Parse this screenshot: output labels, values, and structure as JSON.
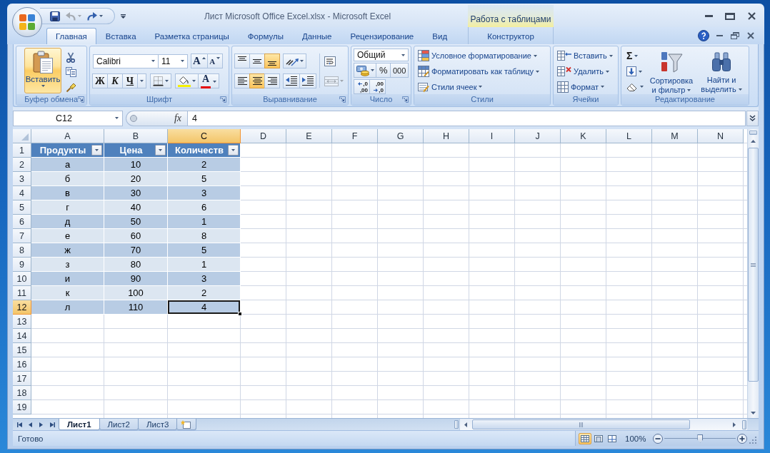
{
  "window": {
    "title": "Лист Microsoft Office Excel.xlsx - Microsoft Excel"
  },
  "quick_access": [
    {
      "kind": "save",
      "disabled": false,
      "dropdown": false
    },
    {
      "kind": "undo",
      "disabled": true,
      "dropdown": true
    },
    {
      "kind": "redo",
      "disabled": false,
      "dropdown": true
    }
  ],
  "tabs": [
    {
      "label": "Главная",
      "selected": true
    },
    {
      "label": "Вставка",
      "selected": false
    },
    {
      "label": "Разметка страницы",
      "selected": false
    },
    {
      "label": "Формулы",
      "selected": false
    },
    {
      "label": "Данные",
      "selected": false
    },
    {
      "label": "Рецензирование",
      "selected": false
    },
    {
      "label": "Вид",
      "selected": false
    }
  ],
  "context_tabs": {
    "title": "Работа с таблицами",
    "tabs": [
      {
        "label": "Конструктор",
        "selected": false
      }
    ]
  },
  "ribbon": {
    "clipboard": {
      "label": "Буфер обмена",
      "launcher": true,
      "paste": {
        "label": "Вставить",
        "highlighted": true
      },
      "tools": [
        {
          "kind": "cut"
        },
        {
          "kind": "copy"
        },
        {
          "kind": "format_painter"
        }
      ]
    },
    "font": {
      "label": "Шрифт",
      "launcher": true,
      "name": "Calibri",
      "size": "11",
      "size_buttons": [
        {
          "kind": "grow",
          "label": "A"
        },
        {
          "kind": "shrink",
          "label": "A"
        }
      ],
      "styles": [
        {
          "kind": "bold",
          "label": "Ж"
        },
        {
          "kind": "italic",
          "label": "К"
        },
        {
          "kind": "underline",
          "label": "Ч"
        }
      ],
      "font_color_label": "A"
    },
    "alignment": {
      "label": "Выравнивание",
      "launcher": true,
      "vertical": [
        {
          "kind": "top",
          "selected": false
        },
        {
          "kind": "middle",
          "selected": false
        },
        {
          "kind": "bottom",
          "selected": true
        }
      ],
      "horizontal": [
        {
          "kind": "left",
          "selected": false
        },
        {
          "kind": "center",
          "selected": true
        },
        {
          "kind": "right",
          "selected": false
        }
      ],
      "merge": {
        "disabled": true
      }
    },
    "number": {
      "label": "Число",
      "launcher": true,
      "format": "Общий",
      "percent": "%",
      "thousands": "000",
      "decimals": [
        {
          "kind": "increase",
          "lines": [
            ",0",
            ",00"
          ]
        },
        {
          "kind": "decrease",
          "lines": [
            ",00",
            ",0"
          ]
        }
      ]
    },
    "styles": {
      "label": "Стили",
      "items": [
        {
          "kind": "conditional",
          "label": "Условное форматирование"
        },
        {
          "kind": "table",
          "label": "Форматировать как таблицу"
        },
        {
          "kind": "cell_styles",
          "label": "Стили ячеек"
        }
      ]
    },
    "cells": {
      "label": "Ячейки",
      "items": [
        {
          "kind": "insert",
          "label": "Вставить"
        },
        {
          "kind": "delete",
          "label": "Удалить"
        },
        {
          "kind": "format",
          "label": "Формат"
        }
      ]
    },
    "editing": {
      "label": "Редактирование",
      "small": [
        {
          "kind": "sum",
          "label": "Σ"
        },
        {
          "kind": "fill"
        },
        {
          "kind": "clear"
        }
      ],
      "big": [
        {
          "kind": "sort",
          "label": "Сортировка и фильтр"
        },
        {
          "kind": "find",
          "label": "Найти и выделить"
        }
      ]
    }
  },
  "formula_bar": {
    "cell": "C12",
    "function_label": "fx",
    "value": "4"
  },
  "sheet": {
    "columns": [
      {
        "label": "A",
        "selected": false
      },
      {
        "label": "B",
        "selected": false
      },
      {
        "label": "C",
        "selected": true
      },
      {
        "label": "D",
        "selected": false
      },
      {
        "label": "E",
        "selected": false
      },
      {
        "label": "F",
        "selected": false
      },
      {
        "label": "G",
        "selected": false
      },
      {
        "label": "H",
        "selected": false
      },
      {
        "label": "I",
        "selected": false
      },
      {
        "label": "J",
        "selected": false
      },
      {
        "label": "K",
        "selected": false
      },
      {
        "label": "L",
        "selected": false
      },
      {
        "label": "M",
        "selected": false
      },
      {
        "label": "N",
        "selected": false
      }
    ],
    "rows": [
      {
        "label": "1",
        "selected": false
      },
      {
        "label": "2",
        "selected": false
      },
      {
        "label": "3",
        "selected": false
      },
      {
        "label": "4",
        "selected": false
      },
      {
        "label": "5",
        "selected": false
      },
      {
        "label": "6",
        "selected": false
      },
      {
        "label": "7",
        "selected": false
      },
      {
        "label": "8",
        "selected": false
      },
      {
        "label": "9",
        "selected": false
      },
      {
        "label": "10",
        "selected": false
      },
      {
        "label": "11",
        "selected": false
      },
      {
        "label": "12",
        "selected": true
      },
      {
        "label": "13",
        "selected": false
      },
      {
        "label": "14",
        "selected": false
      },
      {
        "label": "15",
        "selected": false
      },
      {
        "label": "16",
        "selected": false
      },
      {
        "label": "17",
        "selected": false
      },
      {
        "label": "18",
        "selected": false
      },
      {
        "label": "19",
        "selected": false
      }
    ],
    "table": {
      "header": [
        "Продукты",
        "Цена",
        "Количеств"
      ],
      "rows": [
        {
          "cells": [
            {
              "text": "а",
              "selected": false
            },
            {
              "text": "10",
              "selected": false
            },
            {
              "text": "2",
              "selected": false
            }
          ]
        },
        {
          "cells": [
            {
              "text": "б",
              "selected": false
            },
            {
              "text": "20",
              "selected": false
            },
            {
              "text": "5",
              "selected": false
            }
          ]
        },
        {
          "cells": [
            {
              "text": "в",
              "selected": false
            },
            {
              "text": "30",
              "selected": false
            },
            {
              "text": "3",
              "selected": false
            }
          ]
        },
        {
          "cells": [
            {
              "text": "г",
              "selected": false
            },
            {
              "text": "40",
              "selected": false
            },
            {
              "text": "6",
              "selected": false
            }
          ]
        },
        {
          "cells": [
            {
              "text": "д",
              "selected": false
            },
            {
              "text": "50",
              "selected": false
            },
            {
              "text": "1",
              "selected": false
            }
          ]
        },
        {
          "cells": [
            {
              "text": "е",
              "selected": false
            },
            {
              "text": "60",
              "selected": false
            },
            {
              "text": "8",
              "selected": false
            }
          ]
        },
        {
          "cells": [
            {
              "text": "ж",
              "selected": false
            },
            {
              "text": "70",
              "selected": false
            },
            {
              "text": "5",
              "selected": false
            }
          ]
        },
        {
          "cells": [
            {
              "text": "з",
              "selected": false
            },
            {
              "text": "80",
              "selected": false
            },
            {
              "text": "1",
              "selected": false
            }
          ]
        },
        {
          "cells": [
            {
              "text": "и",
              "selected": false
            },
            {
              "text": "90",
              "selected": false
            },
            {
              "text": "3",
              "selected": false
            }
          ]
        },
        {
          "cells": [
            {
              "text": "к",
              "selected": false
            },
            {
              "text": "100",
              "selected": false
            },
            {
              "text": "2",
              "selected": false
            }
          ]
        },
        {
          "cells": [
            {
              "text": "л",
              "selected": false
            },
            {
              "text": "110",
              "selected": false
            },
            {
              "text": "4",
              "selected": true
            }
          ]
        }
      ]
    }
  },
  "sheet_tabs": [
    {
      "label": "Лист1",
      "selected": true
    },
    {
      "label": "Лист2",
      "selected": false
    },
    {
      "label": "Лист3",
      "selected": false
    }
  ],
  "status_bar": {
    "text": "Готово",
    "views": [
      {
        "kind": "normal",
        "selected": true
      },
      {
        "kind": "page_layout",
        "selected": false
      },
      {
        "kind": "page_break",
        "selected": false
      }
    ],
    "zoom": "100%",
    "zoom_slider": {
      "level": 0.5
    }
  }
}
